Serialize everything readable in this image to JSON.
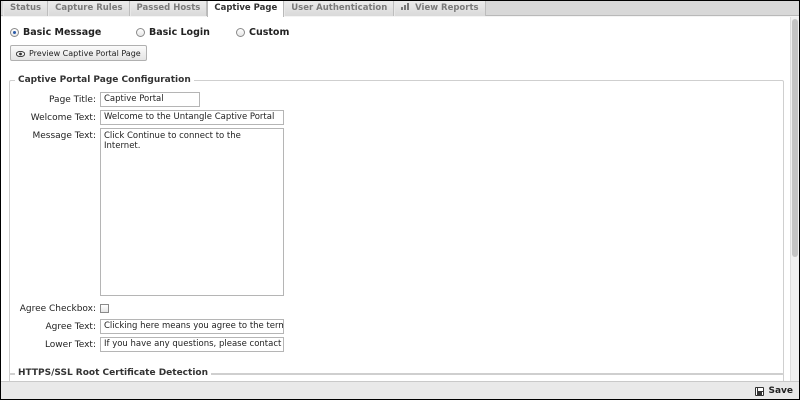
{
  "tabs": [
    {
      "label": "Status",
      "active": false
    },
    {
      "label": "Capture Rules",
      "active": false
    },
    {
      "label": "Passed Hosts",
      "active": false
    },
    {
      "label": "Captive Page",
      "active": true
    },
    {
      "label": "User Authentication",
      "active": false
    },
    {
      "label": "View Reports",
      "active": false,
      "icon": "chart-icon"
    }
  ],
  "page_type": {
    "options": [
      {
        "label": "Basic Message",
        "selected": true
      },
      {
        "label": "Basic Login",
        "selected": false
      },
      {
        "label": "Custom",
        "selected": false
      }
    ]
  },
  "preview_button": {
    "label": "Preview Captive Portal Page",
    "icon": "eye-icon"
  },
  "config": {
    "legend": "Captive Portal Page Configuration",
    "page_title": {
      "label": "Page Title:",
      "value": "Captive Portal"
    },
    "welcome_text": {
      "label": "Welcome Text:",
      "value": "Welcome to the Untangle Captive Portal"
    },
    "message_text": {
      "label": "Message Text:",
      "value": "Click Continue to connect to the Internet."
    },
    "agree_checkbox": {
      "label": "Agree Checkbox:",
      "checked": false
    },
    "agree_text": {
      "label": "Agree Text:",
      "value": "Clicking here means you agree to the terms above."
    },
    "lower_text": {
      "label": "Lower Text:",
      "value": "If you have any questions, please contact your network administrator."
    }
  },
  "https_section": {
    "legend": "HTTPS/SSL Root Certificate Detection"
  },
  "footer": {
    "save_label": "Save",
    "save_icon": "save-icon"
  },
  "colors": {
    "accent": "#2a5aa8",
    "tabbar": "#d8d8d8",
    "footer": "#e9e9e9"
  }
}
